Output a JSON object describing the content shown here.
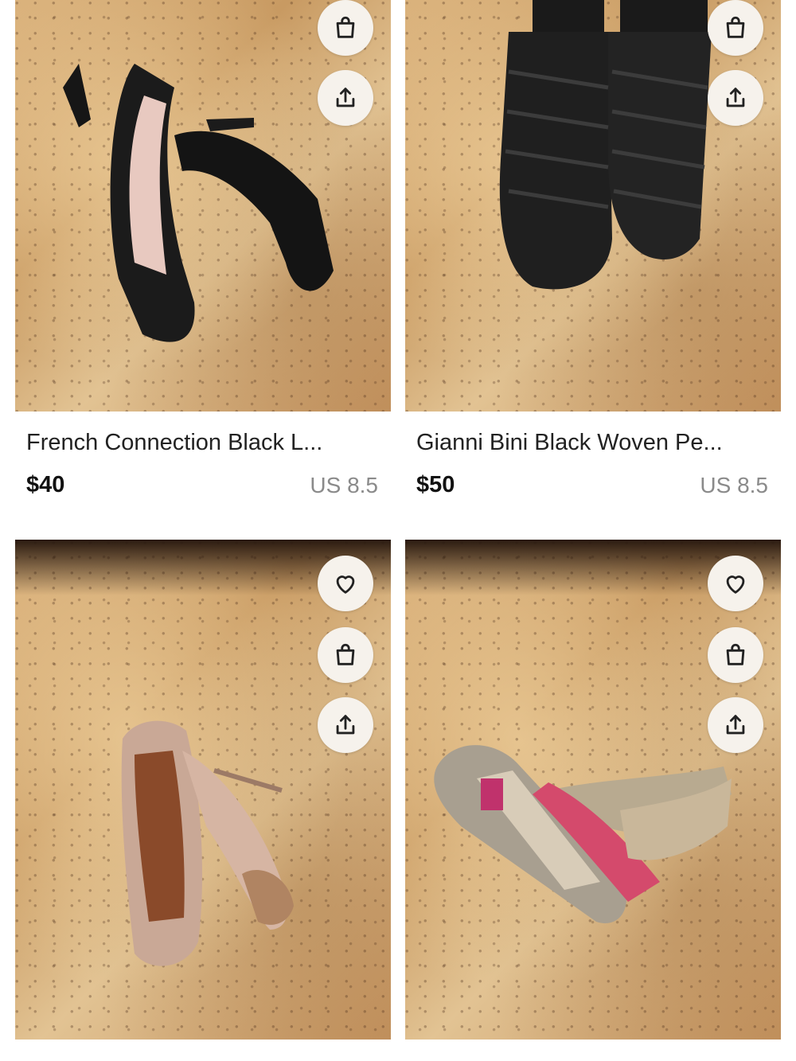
{
  "products": [
    {
      "title": "French Connection Black L...",
      "price": "$40",
      "size": "US 8.5",
      "actions": [
        "bag-icon",
        "share-icon"
      ]
    },
    {
      "title": "Gianni Bini Black Woven Pe...",
      "price": "$50",
      "size": "US 8.5",
      "actions": [
        "bag-icon",
        "share-icon"
      ]
    },
    {
      "actions": [
        "heart-icon",
        "bag-icon",
        "share-icon"
      ]
    },
    {
      "actions": [
        "heart-icon",
        "bag-icon",
        "share-icon"
      ]
    }
  ]
}
